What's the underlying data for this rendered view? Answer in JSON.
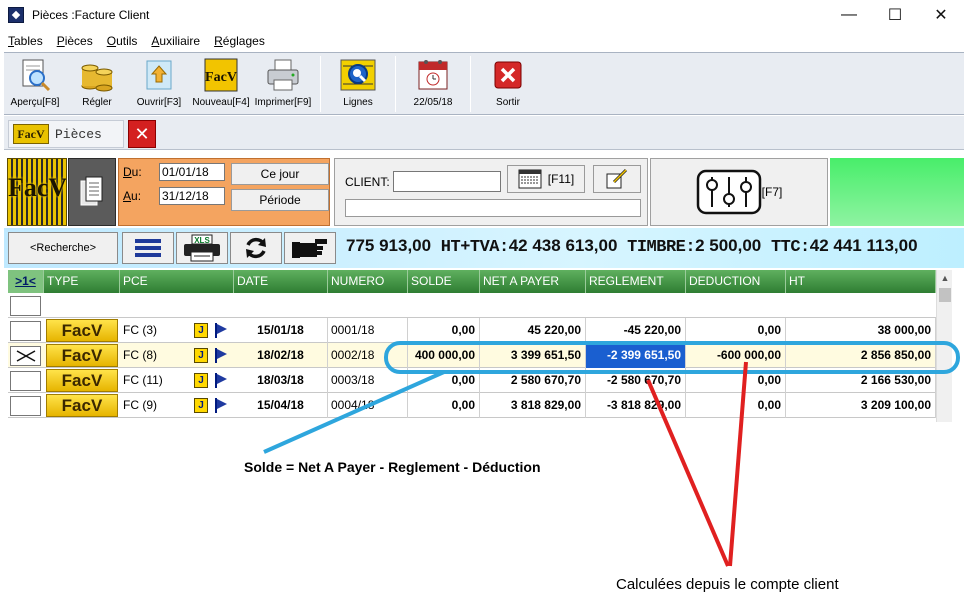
{
  "window": {
    "title": "Pièces :Facture Client",
    "minimize": "—",
    "maximize": "☐",
    "close": "✕"
  },
  "menu": [
    "Tables",
    "Pièces",
    "Outils",
    "Auxiliaire",
    "Réglages"
  ],
  "toolbar": {
    "apercu": "Aperçu[F8]",
    "regler": "Régler",
    "ouvrir": "Ouvrir[F3]",
    "nouveau": "Nouveau[F4]",
    "imprimer": "Imprimer[F9]",
    "lignes": "Lignes",
    "date": "22/05/18",
    "sortir": "Sortir"
  },
  "tab": {
    "logo": "FacV",
    "label": "Pièces"
  },
  "filter": {
    "logo": "FacV",
    "du_label": "Du:",
    "du_value": "01/01/18",
    "au_label": "Au:",
    "au_value": "31/12/18",
    "ce_jour": "Ce jour",
    "periode": "Période",
    "client_label": "CLIENT:",
    "client_value": "",
    "f11": "[F11]",
    "f7": "[F7]"
  },
  "actions": {
    "recherche": "<Recherche>",
    "xls": "XLS"
  },
  "totals": {
    "ht": "775 913,00",
    "tva_label": "HT+TVA:",
    "tva": "42 438 613,00",
    "timbre_label": "TIMBRE:",
    "timbre": "2 500,00",
    "ttc_label": "TTC:",
    "ttc": "42 441 113,00"
  },
  "grid": {
    "columns": [
      ">1<",
      "TYPE",
      "PCE",
      "DATE",
      "NUMERO",
      "SOLDE",
      "NET A PAYER",
      "REGLEMENT",
      "DEDUCTION",
      "HT"
    ],
    "rows": [
      {
        "type": "FacV",
        "pce": "FC (3)",
        "j": "J",
        "date": "15/01/18",
        "numero": "0001/18",
        "solde": "0,00",
        "net": "45 220,00",
        "reglement": "-45 220,00",
        "deduction": "0,00",
        "ht": "38 000,00"
      },
      {
        "type": "FacV",
        "pce": "FC (8)",
        "j": "J",
        "date": "18/02/18",
        "numero": "0002/18",
        "solde": "400 000,00",
        "net": "3 399 651,50",
        "reglement": "-2 399 651,50",
        "deduction": "-600 000,00",
        "ht": "2 856 850,00"
      },
      {
        "type": "FacV",
        "pce": "FC (11)",
        "j": "J",
        "date": "18/03/18",
        "numero": "0003/18",
        "solde": "0,00",
        "net": "2 580 670,70",
        "reglement": "-2 580 670,70",
        "deduction": "0,00",
        "ht": "2 166 530,00"
      },
      {
        "type": "FacV",
        "pce": "FC (9)",
        "j": "J",
        "date": "15/04/18",
        "numero": "0004/18",
        "solde": "0,00",
        "net": "3 818 829,00",
        "reglement": "-3 818 829,00",
        "deduction": "0,00",
        "ht": "3 209 100,00"
      }
    ]
  },
  "annotations": {
    "formula": "Solde = Net A Payer - Reglement - Déduction",
    "source": "Calculées depuis le compte client"
  },
  "colors": {
    "header_green": "#2e7d32",
    "highlight_blue": "#1a5fd0",
    "annotation_blue": "#2ea6dd",
    "annotation_red": "#e02020"
  }
}
